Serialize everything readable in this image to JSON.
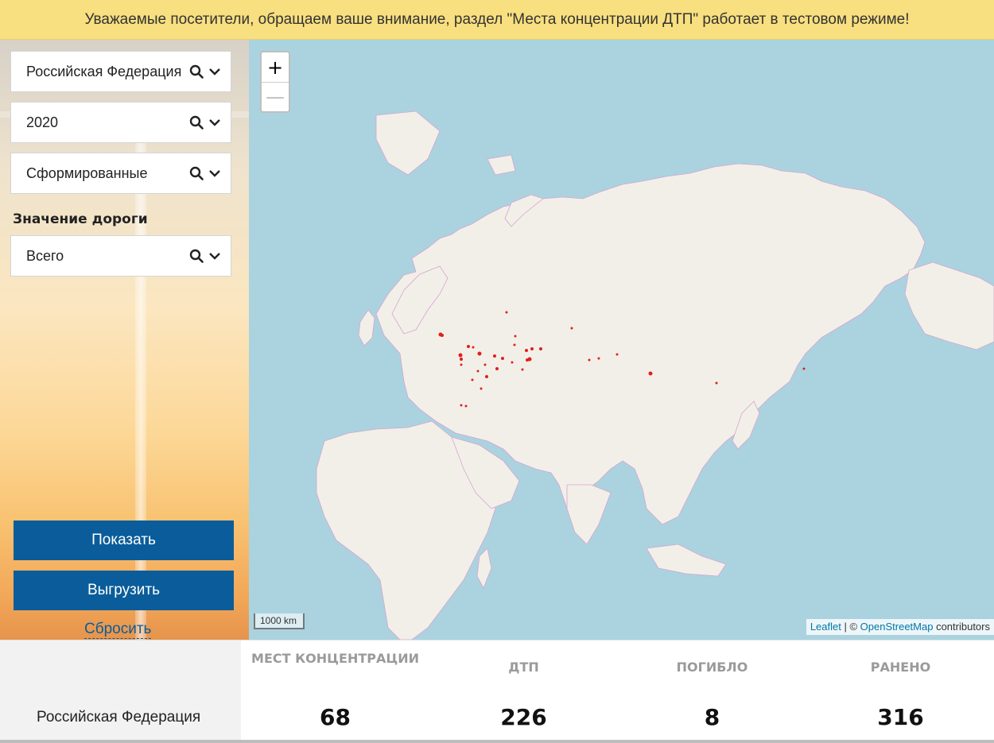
{
  "banner": {
    "text": "Уважаемые посетители, обращаем ваше внимание, раздел \"Места концентрации ДТП\" работает в тестовом режиме!"
  },
  "filters": {
    "region": "Российская Федерация",
    "year": "2020",
    "status": "Сформированные",
    "road_label": "Значение дороги",
    "road": "Всего",
    "icons": [
      "search-icon",
      "chevron-down-icon"
    ]
  },
  "buttons": {
    "show": "Показать",
    "export": "Выгрузить",
    "reset": "Сбросить"
  },
  "map": {
    "zoom_in": "+",
    "zoom_out": "—",
    "scale": "1000 km",
    "attribution": {
      "leaflet": "Leaflet",
      "separator": " | © ",
      "osm": "OpenStreetMap",
      "contributors": " contributors"
    },
    "colors": {
      "water": "#aad3df",
      "land": "#f2efe9",
      "borders": "#d6a4cf",
      "markers": "#e0201a"
    }
  },
  "stats": {
    "region": "Российская Федерация",
    "columns": [
      {
        "label": "МЕСТ КОНЦЕНТРАЦИИ",
        "value": "68"
      },
      {
        "label": "ДТП",
        "value": "226"
      },
      {
        "label": "ПОГИБЛО",
        "value": "8"
      },
      {
        "label": "РАНЕНО",
        "value": "316"
      }
    ]
  }
}
